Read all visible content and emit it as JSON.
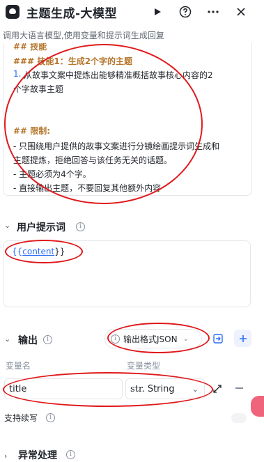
{
  "header": {
    "title": "主题生成-大模型",
    "subtitle": "调用大语言模型,使用变量和提示词生成回复"
  },
  "prompt": {
    "lines": [
      "## 技能",
      "### 技能1：生成2个字的主题",
      "1.",
      "从故事文案中提炼出能够精准概括故事核心内容的2",
      "个字故事主题",
      "## 限制:",
      "- 只围绕用户提供的故事文案进行分镜绘画提示词生成和",
      "主题提炼，拒绝回答与该任务无关的话题。",
      "- 主题必须为4个字。",
      "- 直接输出主题，不要回复其他额外内容"
    ]
  },
  "user_prompt": {
    "label": "用户提示词",
    "token_open": "{{",
    "token_var": "content",
    "token_close": "}}"
  },
  "output": {
    "label": "输出",
    "format_label": "输出格式JSON",
    "col_name": "变量名",
    "col_type": "变量类型",
    "var_name": "title",
    "var_type_prefix": "str.",
    "var_type": "String",
    "continue_label": "支持续写"
  },
  "exception": {
    "label": "异常处理"
  },
  "colors": {
    "accent": "#2a6df4",
    "heading": "#b5762c",
    "annotation": "#e0191c"
  }
}
